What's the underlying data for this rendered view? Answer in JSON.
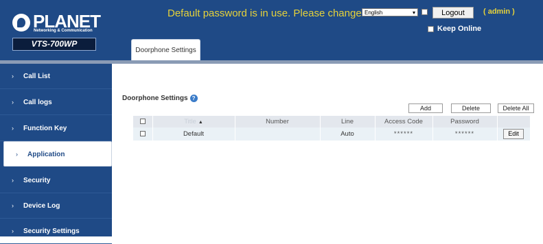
{
  "header": {
    "logo_text": "PLANET",
    "logo_subtext": "Networking & Communication",
    "model": "VTS-700WP",
    "warning": "Default password is in use. Please change",
    "language": "English",
    "logout_label": "Logout",
    "user": "( admin )",
    "keep_online_label": "Keep Online",
    "tab_label": "Doorphone Settings"
  },
  "sidebar": {
    "items": [
      {
        "label": "Call List"
      },
      {
        "label": "Call logs"
      },
      {
        "label": "Function Key"
      },
      {
        "label": "Application",
        "active": true
      },
      {
        "label": "Security"
      },
      {
        "label": "Device Log"
      },
      {
        "label": "Security Settings"
      }
    ]
  },
  "main": {
    "section_title": "Doorphone Settings",
    "help_icon": "question-mark-icon",
    "buttons": {
      "add": "Add",
      "delete": "Delete",
      "delete_all": "Delete All"
    },
    "table": {
      "columns": [
        "Title",
        "Number",
        "Line",
        "Access Code",
        "Password",
        ""
      ],
      "rows": [
        {
          "title": "Default",
          "number": "",
          "line": "Auto",
          "access_code": "******",
          "password": "******",
          "action": "Edit"
        }
      ]
    }
  },
  "colors": {
    "header_bg": "#1f4a86",
    "warning": "#e6d23a",
    "row_bg": "#eaf1f6"
  }
}
